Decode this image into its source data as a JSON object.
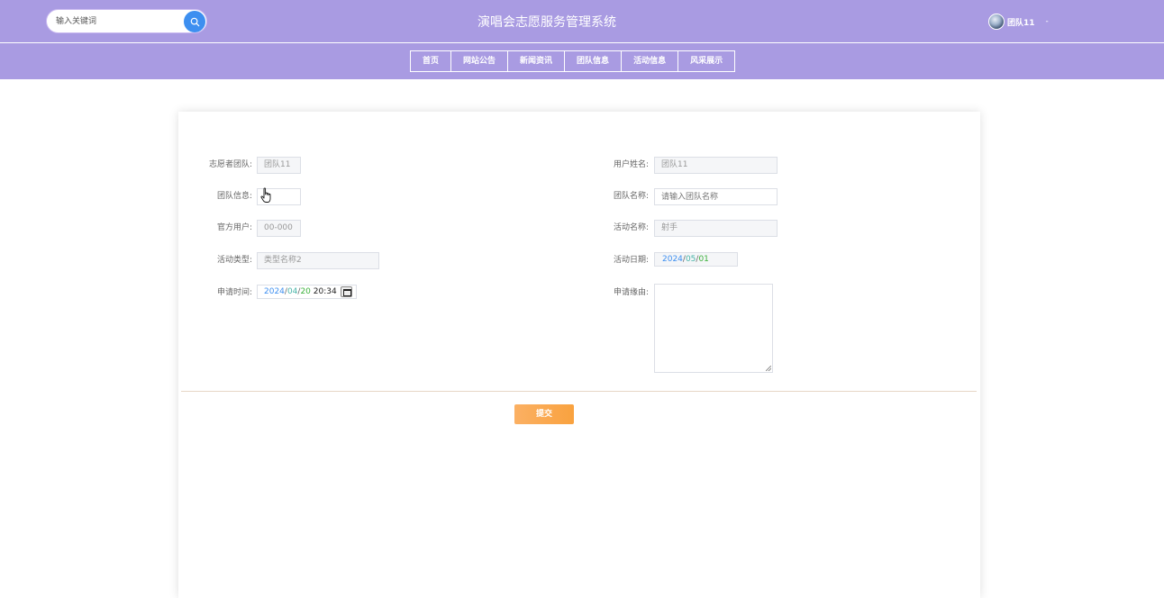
{
  "header": {
    "search_placeholder": "输入关键词",
    "title": "演唱会志愿服务管理系统",
    "user_name": "团队11",
    "user_caret": "-"
  },
  "nav": {
    "items": [
      {
        "label": "首页"
      },
      {
        "label": "网站公告"
      },
      {
        "label": "新闻资讯"
      },
      {
        "label": "团队信息"
      },
      {
        "label": "活动信息"
      },
      {
        "label": "风采展示"
      }
    ]
  },
  "form": {
    "volunteer_team_label": "志愿者团队:",
    "volunteer_team_value": "团队11",
    "user_name_label": "用户姓名:",
    "user_name_value": "团队11",
    "team_info_label": "团队信息:",
    "team_info_value": "",
    "team_name_label": "团队名称:",
    "team_name_placeholder": "请输入团队名称",
    "official_user_label": "官方用户:",
    "official_user_value": "00-000",
    "activity_name_label": "活动名称:",
    "activity_name_value": "射手",
    "activity_type_label": "活动类型:",
    "activity_type_value": "类型名称2",
    "activity_date_label": "活动日期:",
    "activity_date": {
      "year": "2024",
      "month": "05",
      "day": "01",
      "sep": "/"
    },
    "apply_time_label": "申请时间:",
    "apply_time": {
      "year": "2024",
      "month": "04",
      "day": "20",
      "time": "20:34",
      "sep": "/"
    },
    "apply_reason_label": "申请缘由:",
    "apply_reason_value": "",
    "submit_label": "提交"
  },
  "colors": {
    "header_bg": "#a99be2",
    "search_button": "#3d8ff0",
    "submit_button": "#f9a23f"
  }
}
